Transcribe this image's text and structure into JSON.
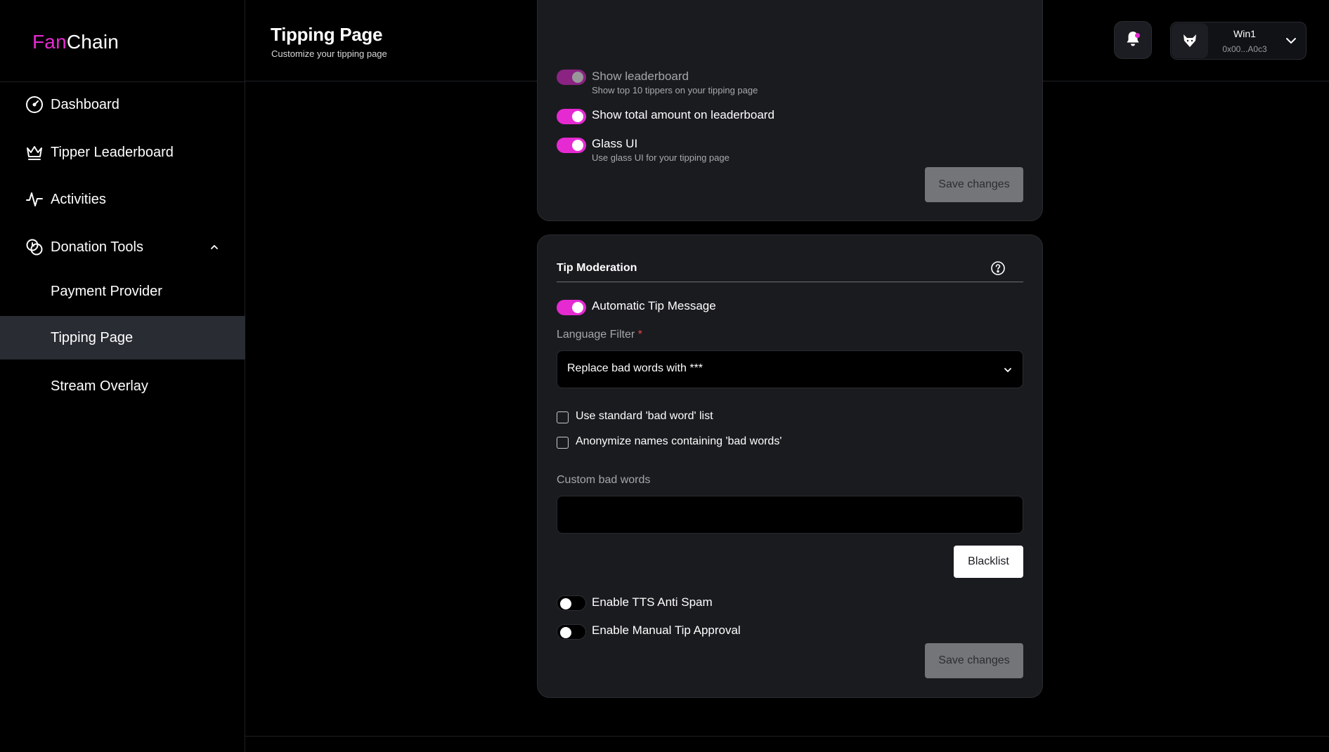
{
  "brand": {
    "part1": "Fan",
    "part2": "Chain",
    "accent_color": "#e62ad2"
  },
  "sidebar": {
    "items": [
      {
        "label": "Dashboard",
        "icon": "dashboard-gauge-icon"
      },
      {
        "label": "Tipper Leaderboard",
        "icon": "crown-icon"
      },
      {
        "label": "Activities",
        "icon": "activity-pulse-icon"
      },
      {
        "label": "Donation Tools",
        "icon": "coins-icon",
        "expanded": true
      },
      {
        "label": "Payment Provider"
      },
      {
        "label": "Tipping Page",
        "active": true
      },
      {
        "label": "Stream Overlay"
      }
    ]
  },
  "header": {
    "title": "Tipping Page",
    "subtitle": "Customize your tipping page",
    "notifications_icon": "bell-icon",
    "user": {
      "name": "Win1",
      "address": "0x00...A0c3",
      "avatar_icon": "wolf-avatar-icon"
    }
  },
  "appearance_card": {
    "show_leaderboard": {
      "label": "Show leaderboard",
      "description": "Show top 10 tippers on your tipping page",
      "enabled": true
    },
    "show_total": {
      "label": "Show total amount on leaderboard",
      "enabled": true
    },
    "glass_ui": {
      "label": "Glass UI",
      "description": "Use glass UI for your tipping page",
      "enabled": true
    },
    "save_label": "Save changes"
  },
  "moderation_card": {
    "title": "Tip Moderation",
    "help_icon": "question-circle-icon",
    "auto_message": {
      "label": "Automatic Tip Message",
      "enabled": true
    },
    "language_filter": {
      "label": "Language Filter",
      "required_mark": "*",
      "value": "Replace bad words with ***"
    },
    "use_standard_list": {
      "label": "Use standard 'bad word' list",
      "checked": false
    },
    "anonymize_names": {
      "label": "Anonymize names containing 'bad words'",
      "checked": false
    },
    "custom_bad_words": {
      "label": "Custom bad words",
      "value": "",
      "placeholder": ""
    },
    "blacklist_label": "Blacklist",
    "tts_anti_spam": {
      "label": "Enable TTS Anti Spam",
      "enabled": false
    },
    "manual_approval": {
      "label": "Enable Manual Tip Approval",
      "enabled": false
    },
    "save_label": "Save changes"
  }
}
